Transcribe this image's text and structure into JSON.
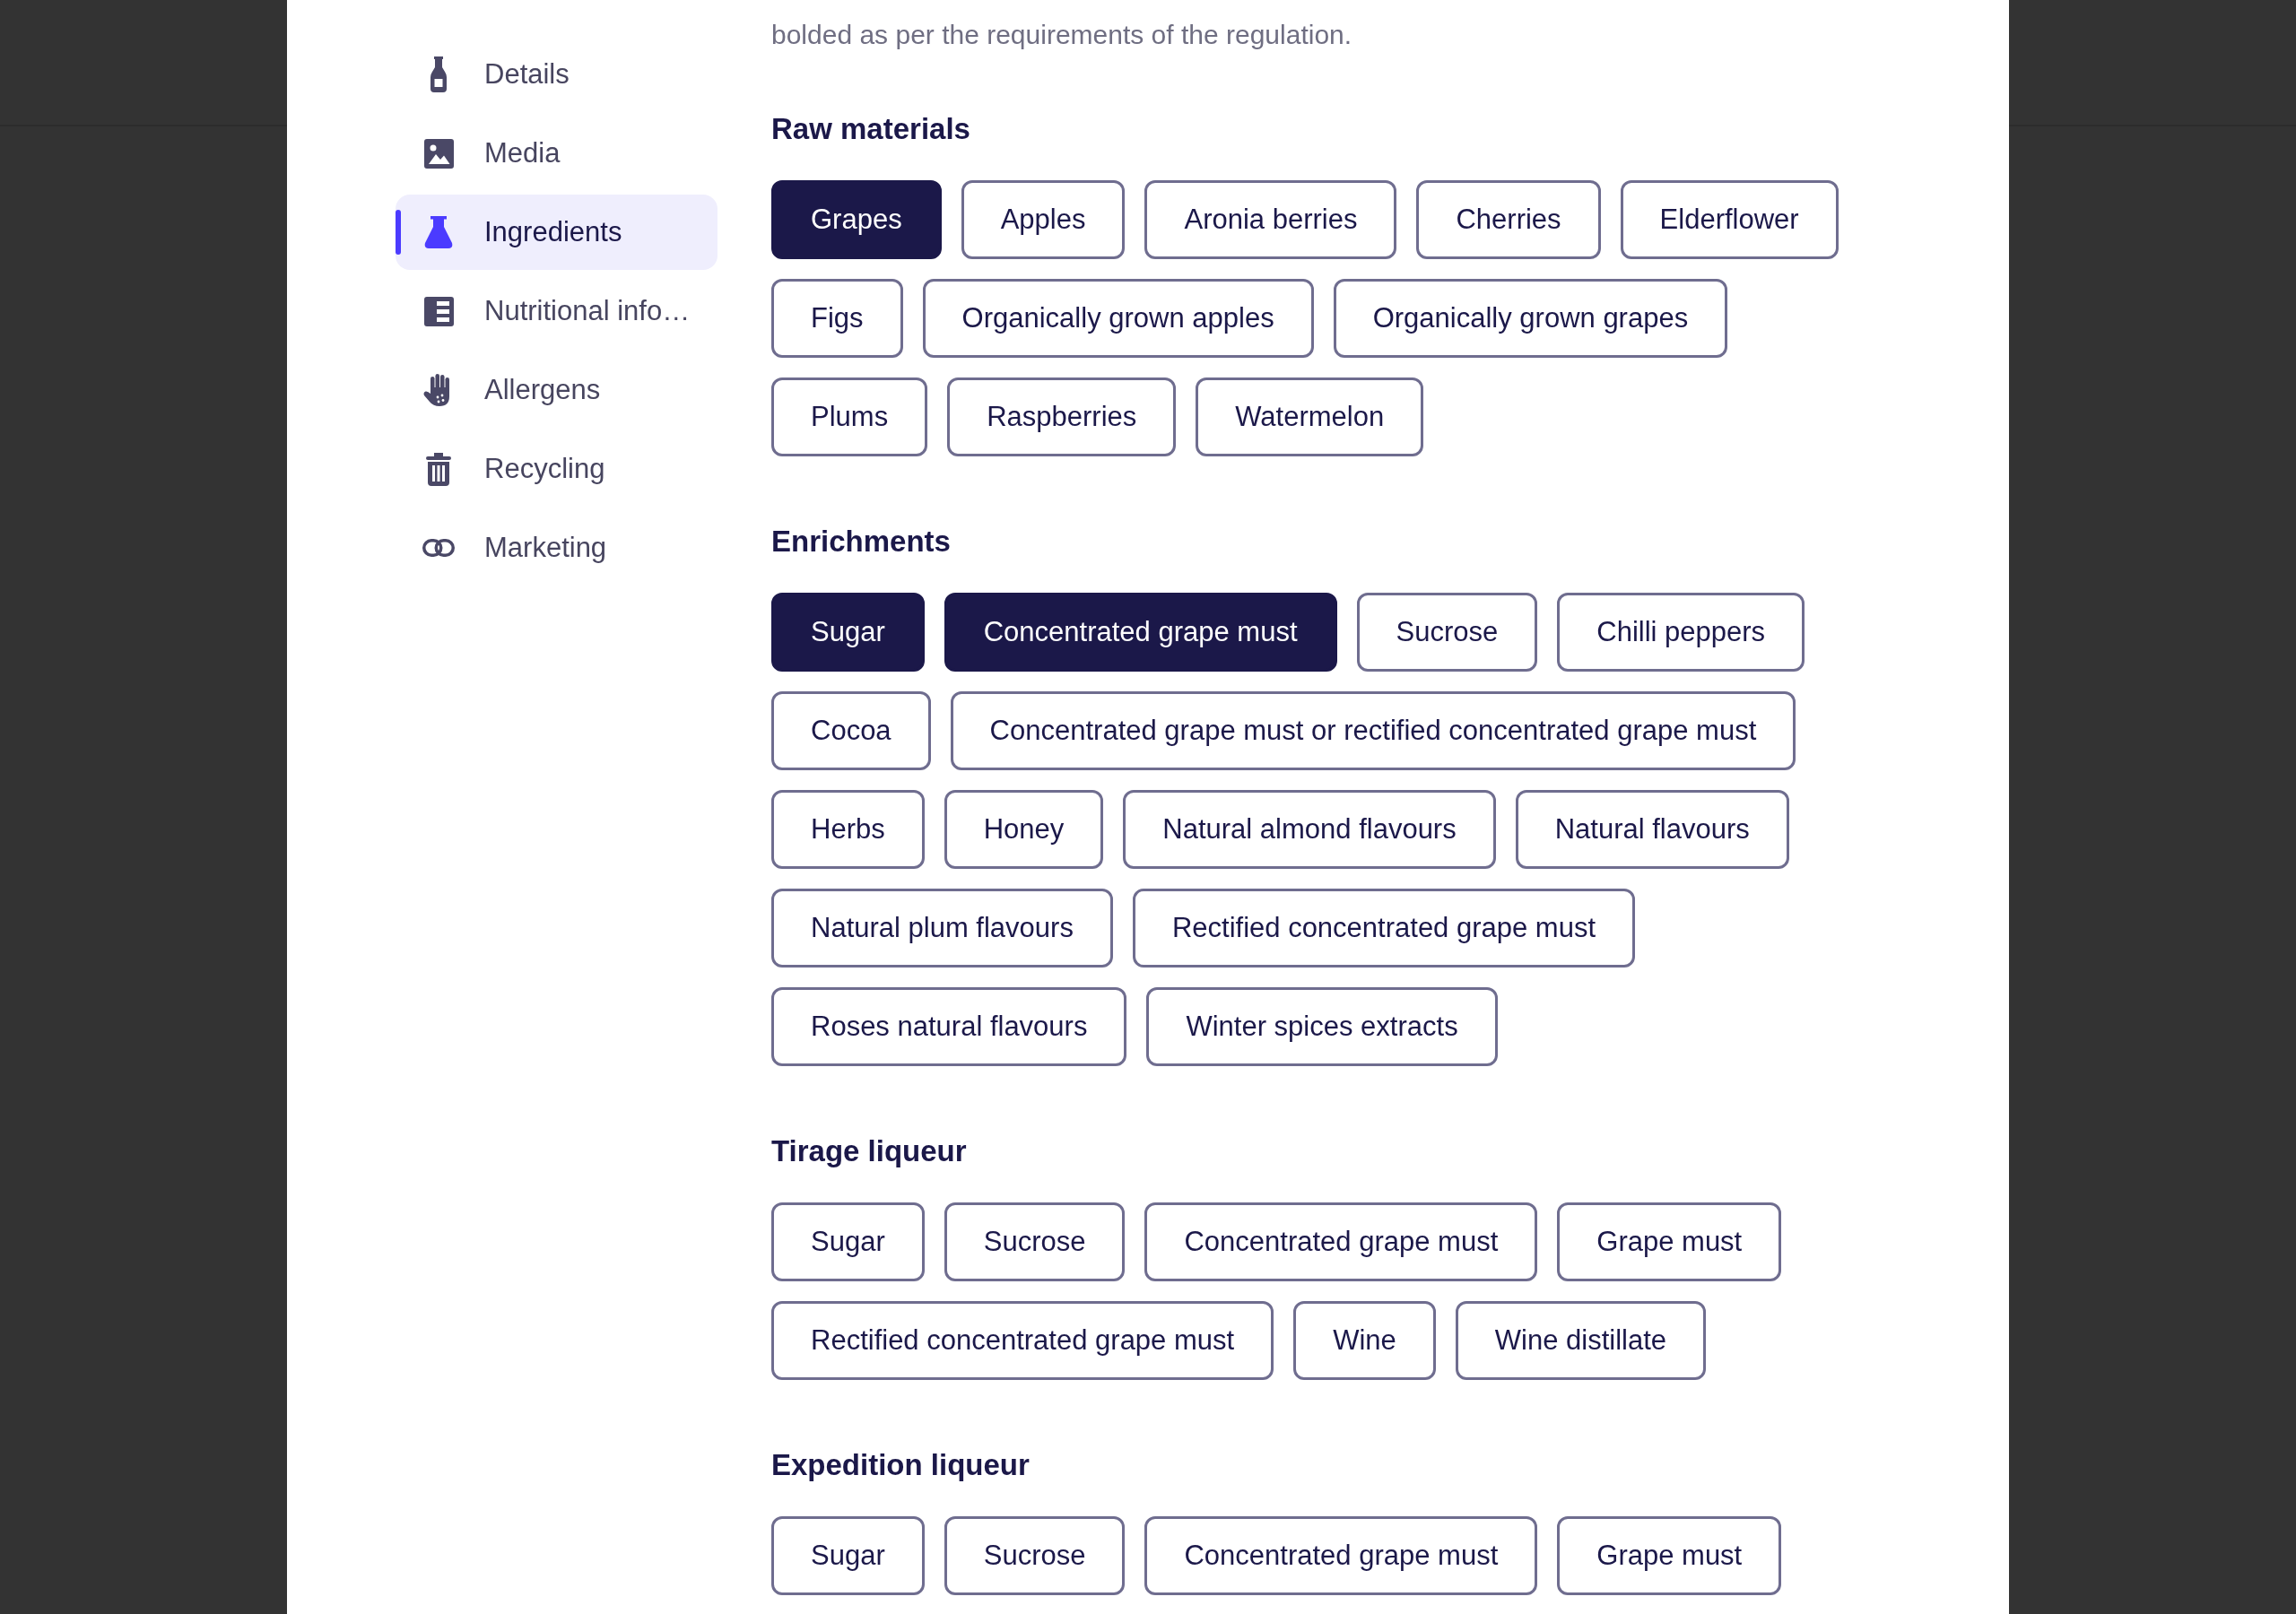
{
  "sidebar": {
    "items": [
      {
        "label": "Details",
        "selected": false
      },
      {
        "label": "Media",
        "selected": false
      },
      {
        "label": "Ingredients",
        "selected": true
      },
      {
        "label": "Nutritional info…",
        "selected": false
      },
      {
        "label": "Allergens",
        "selected": false
      },
      {
        "label": "Recycling",
        "selected": false
      },
      {
        "label": "Marketing",
        "selected": false
      }
    ]
  },
  "description": "bolded as per the requirements of the regulation.",
  "sections": [
    {
      "title": "Raw materials",
      "options": [
        {
          "label": "Grapes",
          "selected": true
        },
        {
          "label": "Apples",
          "selected": false
        },
        {
          "label": "Aronia berries",
          "selected": false
        },
        {
          "label": "Cherries",
          "selected": false
        },
        {
          "label": "Elderflower",
          "selected": false
        },
        {
          "label": "Figs",
          "selected": false
        },
        {
          "label": "Organically grown apples",
          "selected": false
        },
        {
          "label": "Organically grown grapes",
          "selected": false
        },
        {
          "label": "Plums",
          "selected": false
        },
        {
          "label": "Raspberries",
          "selected": false
        },
        {
          "label": "Watermelon",
          "selected": false
        }
      ]
    },
    {
      "title": "Enrichments",
      "options": [
        {
          "label": "Sugar",
          "selected": true
        },
        {
          "label": "Concentrated grape must",
          "selected": true
        },
        {
          "label": "Sucrose",
          "selected": false
        },
        {
          "label": "Chilli peppers",
          "selected": false
        },
        {
          "label": "Cocoa",
          "selected": false
        },
        {
          "label": "Concentrated grape must or rectified concentrated grape must",
          "selected": false
        },
        {
          "label": "Herbs",
          "selected": false
        },
        {
          "label": "Honey",
          "selected": false
        },
        {
          "label": "Natural almond flavours",
          "selected": false
        },
        {
          "label": "Natural flavours",
          "selected": false
        },
        {
          "label": "Natural plum flavours",
          "selected": false
        },
        {
          "label": "Rectified concentrated grape must",
          "selected": false
        },
        {
          "label": "Roses natural flavours",
          "selected": false
        },
        {
          "label": "Winter spices extracts",
          "selected": false
        }
      ]
    },
    {
      "title": "Tirage liqueur",
      "options": [
        {
          "label": "Sugar",
          "selected": false
        },
        {
          "label": "Sucrose",
          "selected": false
        },
        {
          "label": "Concentrated grape must",
          "selected": false
        },
        {
          "label": "Grape must",
          "selected": false
        },
        {
          "label": "Rectified concentrated grape must",
          "selected": false
        },
        {
          "label": "Wine",
          "selected": false
        },
        {
          "label": "Wine distillate",
          "selected": false
        }
      ]
    },
    {
      "title": "Expedition liqueur",
      "options": [
        {
          "label": "Sugar",
          "selected": false
        },
        {
          "label": "Sucrose",
          "selected": false
        },
        {
          "label": "Concentrated grape must",
          "selected": false
        },
        {
          "label": "Grape must",
          "selected": false
        }
      ]
    }
  ]
}
